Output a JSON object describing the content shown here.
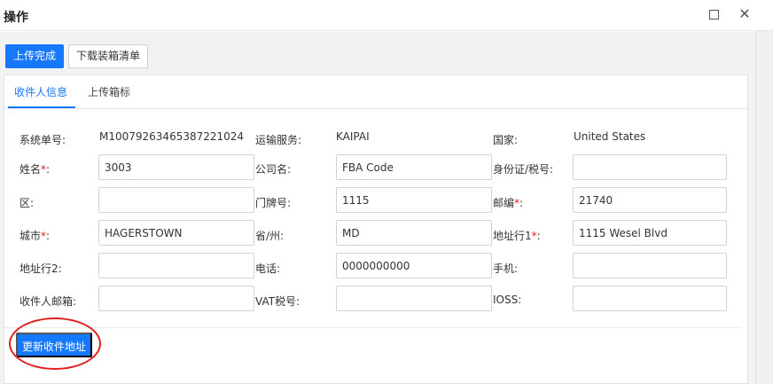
{
  "dialog": {
    "title": "操作"
  },
  "toolbar": {
    "upload_done": "上传完成",
    "download_list": "下载装箱清单"
  },
  "tabs": [
    {
      "label": "收件人信息",
      "active": true
    },
    {
      "label": "上传箱标",
      "active": false
    }
  ],
  "form": {
    "system_no": {
      "label": "系统单号:",
      "value": "M10079263465387221024"
    },
    "transport_service": {
      "label": "运输服务:",
      "value": "KAIPAI"
    },
    "country": {
      "label": "国家:",
      "value": "United States"
    },
    "name": {
      "label": "姓名",
      "value": "3003"
    },
    "company": {
      "label": "公司名:",
      "value": "FBA Code"
    },
    "id_tax_no": {
      "label": "身份证/税号:",
      "value": ""
    },
    "district": {
      "label": "区:",
      "value": ""
    },
    "door_no": {
      "label": "门牌号:",
      "value": "1115"
    },
    "postcode": {
      "label": "邮编",
      "value": "21740"
    },
    "city": {
      "label": "城市",
      "value": "HAGERSTOWN"
    },
    "state": {
      "label": "省/州:",
      "value": "MD"
    },
    "address1": {
      "label": "地址行1",
      "value": "1115 Wesel Blvd"
    },
    "address2": {
      "label": "地址行2:",
      "value": ""
    },
    "phone": {
      "label": "电话:",
      "value": "0000000000"
    },
    "mobile": {
      "label": "手机:",
      "value": ""
    },
    "email": {
      "label": "收件人邮箱:",
      "value": ""
    },
    "vat_no": {
      "label": "VAT税号:",
      "value": ""
    },
    "ioss": {
      "label": "IOSS:",
      "value": ""
    },
    "required_mark": "*",
    "colon": ":"
  },
  "actions": {
    "update_address": "更新收件地址"
  },
  "colors": {
    "primary": "#1677ff",
    "required": "#e02020",
    "highlight": "#e02020"
  }
}
